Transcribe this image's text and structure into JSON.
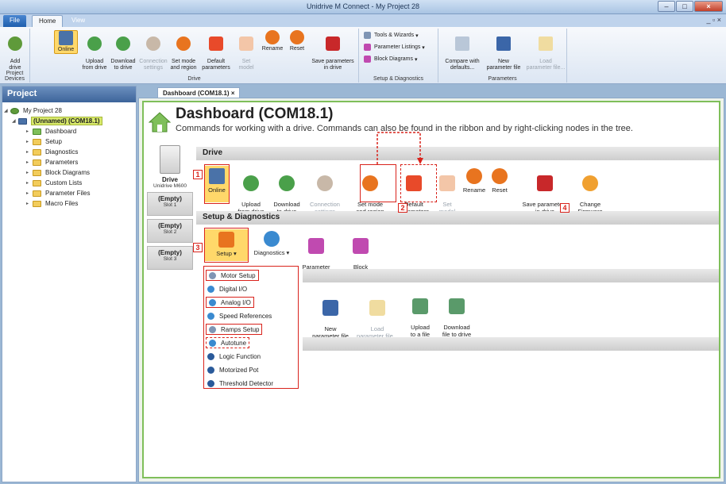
{
  "window": {
    "title": "Unidrive M Connect - My Project 28"
  },
  "menu": {
    "file": "File",
    "home": "Home",
    "view": "View"
  },
  "ribbon": {
    "groups": {
      "project_devices": {
        "label": "Project Devices",
        "add": "Add\ndrive"
      },
      "drive": {
        "label": "Drive",
        "online": "Online",
        "upload": "Upload\nfrom drive",
        "download": "Download\nto drive",
        "connection": "Connection\nsettings",
        "setmode": "Set mode\nand region",
        "default": "Default\nparameters",
        "setmodel": "Set\nmodel",
        "rename": "Rename",
        "reset": "Reset",
        "save": "Save parameters\nin drive"
      },
      "setup": {
        "label": "Setup & Diagnostics",
        "tools": "Tools & Wizards",
        "listings": "Parameter Listings",
        "block": "Block Diagrams"
      },
      "parameters": {
        "label": "Parameters",
        "compare": "Compare with\ndefaults...",
        "new": "New\nparameter file",
        "load": "Load\nparameter file..."
      }
    }
  },
  "project": {
    "title": "Project",
    "root": "My Project 28",
    "drive": "(Unnamed) (COM18.1)",
    "items": [
      "Dashboard",
      "Setup",
      "Diagnostics",
      "Parameters",
      "Block Diagrams",
      "Custom Lists",
      "Parameter Files",
      "Macro Files"
    ]
  },
  "doc_tab": "Dashboard (COM18.1)",
  "dashboard": {
    "title": "Dashboard (COM18.1)",
    "subtitle": "Commands for working with a drive. Commands can also be found in the ribbon and by right-clicking nodes in the tree.",
    "drive_name": "Drive",
    "drive_model": "Unidrive M600",
    "slots": [
      {
        "label": "(Empty)",
        "slot": "Slot 1"
      },
      {
        "label": "(Empty)",
        "slot": "Slot 2"
      },
      {
        "label": "(Empty)",
        "slot": "Slot 3"
      }
    ],
    "sections": {
      "drive": "Drive",
      "setup": "Setup & Diagnostics"
    },
    "drive_buttons": {
      "online": "Online",
      "upload": "Upload\nfrom drive",
      "download": "Download\nto drive",
      "connection": "Connection\nsettings",
      "setmode": "Set mode\nand region",
      "default": "Default\nparameters",
      "setmodel": "Set\nmodel",
      "rename": "Rename",
      "reset": "Reset",
      "save": "Save parameters\nin drive",
      "firmware": "Change\nFirmware"
    },
    "setup_buttons": {
      "setup": "Setup",
      "diagnostics": "Diagnostics",
      "listings": "Parameter\nListings",
      "block": "Block\nDiagrams"
    },
    "param_buttons": {
      "new": "New\nparameter file",
      "load": "Load\nparameter file...",
      "upload": "Upload\nto a file",
      "download": "Download\nfile to drive"
    },
    "setup_menu": [
      "Motor Setup",
      "Digital I/O",
      "Analog I/O",
      "Speed References",
      "Ramps Setup",
      "Autotune",
      "Logic Function",
      "Motorized Pot",
      "Threshold Detector"
    ],
    "annotations": [
      "1",
      "2",
      "3",
      "4"
    ]
  },
  "colors": {
    "highlight": "#ffd86a",
    "annotation": "#d9231c",
    "accent_green": "#7fbf5a"
  }
}
